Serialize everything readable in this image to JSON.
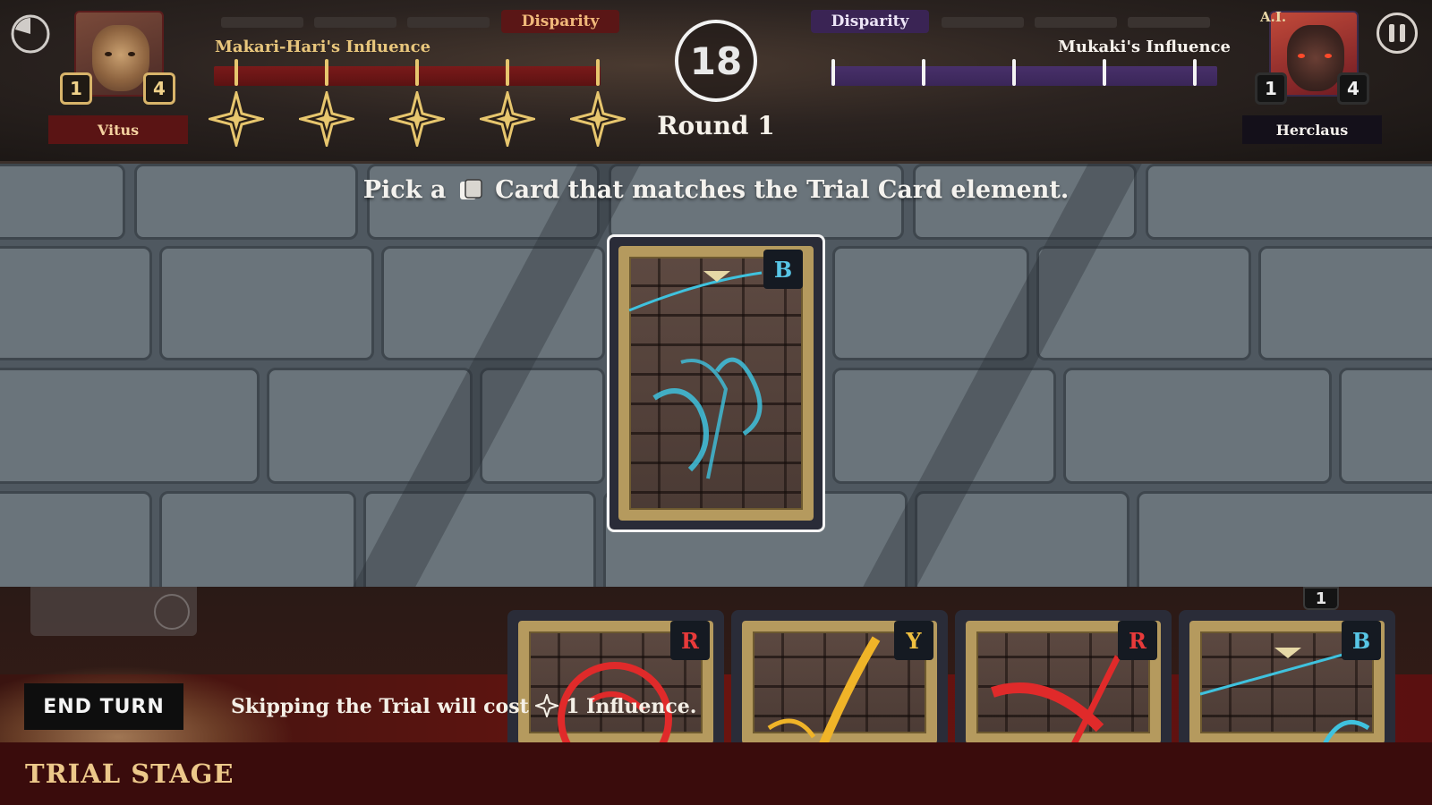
{
  "hud": {
    "player": {
      "name": "Vitus",
      "counter_left": "1",
      "counter_right": "4",
      "influence_label": "Makari-Hari's Influence",
      "disparity_label": "Disparity",
      "color": "#7a1a1a"
    },
    "opponent": {
      "name": "Herclaus",
      "tag": "A.I.",
      "counter_left": "1",
      "counter_right": "4",
      "influence_label": "Mukaki's Influence",
      "disparity_label": "Disparity",
      "color": "#48306a"
    },
    "timer": "18",
    "round": "Round 1",
    "icons": [
      "round-progress-icon",
      "pause-icon",
      "influence-star-icon"
    ]
  },
  "board": {
    "instruction_before": "Pick a",
    "instruction_after": "Card that matches the Trial Card element.",
    "trial_card": {
      "element": "B",
      "element_color": "#58c6e6"
    }
  },
  "hand": {
    "cards": [
      {
        "element": "R",
        "color": "#e83a3a"
      },
      {
        "element": "Y",
        "color": "#f0c040"
      },
      {
        "element": "R",
        "color": "#e83a3a"
      },
      {
        "element": "B",
        "color": "#58c6e6"
      }
    ],
    "deck_count": "1"
  },
  "footer": {
    "end_turn_label": "END TURN",
    "skip_before": "Skipping the Trial will cost",
    "skip_after": "1 Influence.",
    "stage_label": "TRIAL STAGE"
  }
}
